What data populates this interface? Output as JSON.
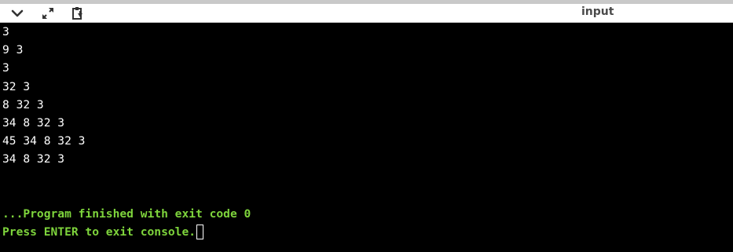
{
  "toolbar": {
    "collapse_icon": "chevron-down-icon",
    "expand_icon": "expand-arrows-icon",
    "copy_icon": "clipboard-icon",
    "tab_label": "input"
  },
  "console": {
    "output_lines": [
      "3",
      "9 3",
      "3",
      "32 3",
      "8 32 3",
      "34 8 32 3",
      "45 34 8 32 3",
      "34 8 32 3",
      "",
      ""
    ],
    "finish_message": "...Program finished with exit code 0",
    "exit_prompt": "Press ENTER to exit console."
  },
  "colors": {
    "background": "#000000",
    "text": "#ffffff",
    "status_text": "#7ed43c",
    "toolbar": "#ffffff"
  }
}
